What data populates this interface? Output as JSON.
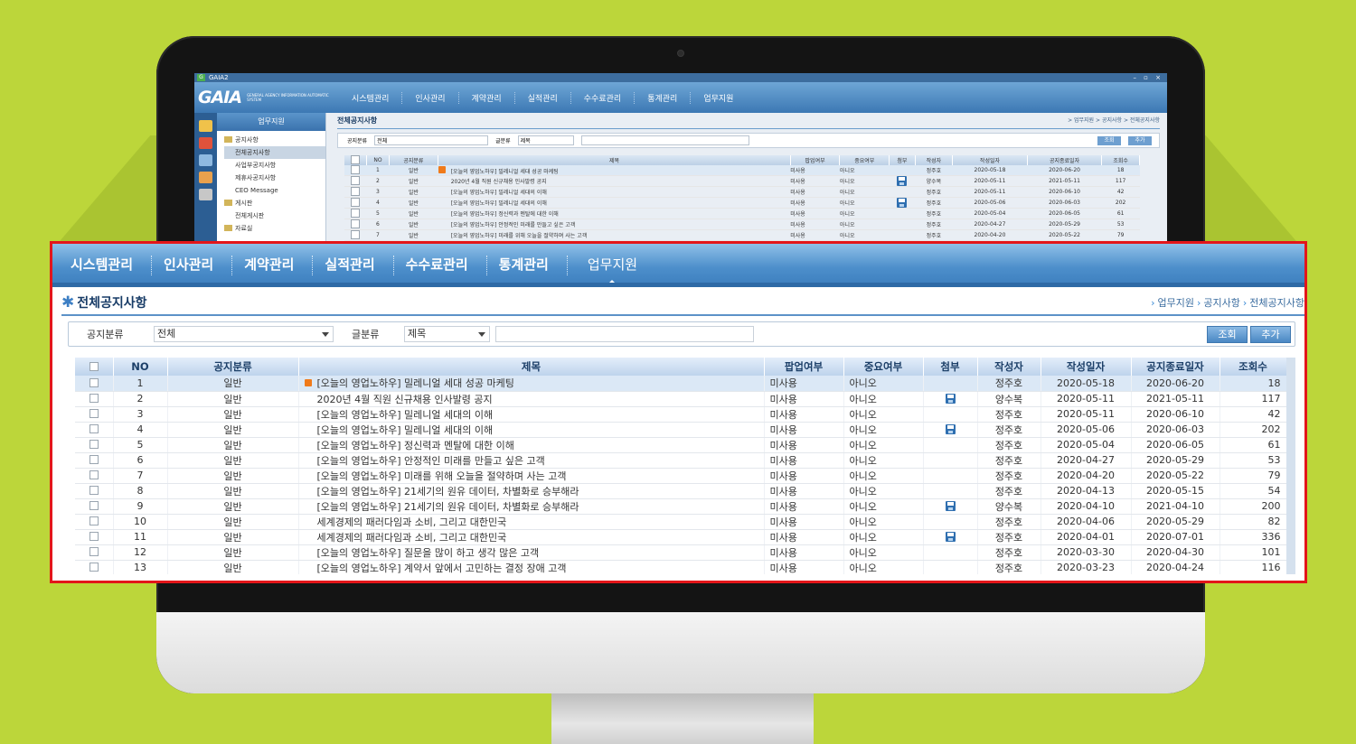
{
  "screen": {
    "app_title": "GAIA2",
    "logo": "GAIA",
    "logo_sub": "GENERAL AGENCY INFORMATION AUTOMATIC SYSTEM",
    "sidebar_title": "업무지원",
    "tree": [
      {
        "label": "공지사항",
        "type": "folder"
      },
      {
        "label": "전체공지사항",
        "type": "page",
        "selected": true
      },
      {
        "label": "사업부공지사항",
        "type": "page"
      },
      {
        "label": "제휴사공지사항",
        "type": "page"
      },
      {
        "label": "CEO Message",
        "type": "page"
      },
      {
        "label": "게시판",
        "type": "folder"
      },
      {
        "label": "전체게시판",
        "type": "page"
      },
      {
        "label": "자료실",
        "type": "folder"
      }
    ]
  },
  "menu": [
    {
      "label": "시스템관리"
    },
    {
      "label": "인사관리"
    },
    {
      "label": "계약관리"
    },
    {
      "label": "실적관리"
    },
    {
      "label": "수수료관리"
    },
    {
      "label": "통계관리"
    },
    {
      "label": "업무지원",
      "active": true
    }
  ],
  "page": {
    "title": "전체공지사항",
    "breadcrumb": [
      "업무지원",
      "공지사항",
      "전체공지사항"
    ]
  },
  "filter": {
    "category_label": "공지분류",
    "category_value": "전체",
    "type_label": "글분류",
    "type_value": "제목",
    "search_value": "",
    "search_button": "조회",
    "add_button": "추가"
  },
  "table": {
    "columns": [
      "NO",
      "공지분류",
      "제목",
      "팝업여부",
      "중요여부",
      "첨부",
      "작성자",
      "작성일자",
      "공지종료일자",
      "조회수"
    ],
    "rows": [
      {
        "no": "1",
        "category": "일반",
        "title": "[오늘의 영업노하우] 밀레니얼 세대 성공 마케팅",
        "popup": "미사용",
        "important": "아니오",
        "attach": false,
        "author": "정주호",
        "date": "2020-05-18",
        "end": "2020-06-20",
        "views": "18",
        "new": true
      },
      {
        "no": "2",
        "category": "일반",
        "title": "2020년 4월 직원 신규채용 인사발령 공지",
        "popup": "미사용",
        "important": "아니오",
        "attach": true,
        "author": "양수복",
        "date": "2020-05-11",
        "end": "2021-05-11",
        "views": "117"
      },
      {
        "no": "3",
        "category": "일반",
        "title": "[오늘의 영업노하우] 밀레니얼 세대의 이해",
        "popup": "미사용",
        "important": "아니오",
        "attach": false,
        "author": "정주호",
        "date": "2020-05-11",
        "end": "2020-06-10",
        "views": "42"
      },
      {
        "no": "4",
        "category": "일반",
        "title": "[오늘의 영업노하우] 밀레니얼 세대의 이해",
        "popup": "미사용",
        "important": "아니오",
        "attach": true,
        "author": "정주호",
        "date": "2020-05-06",
        "end": "2020-06-03",
        "views": "202"
      },
      {
        "no": "5",
        "category": "일반",
        "title": "[오늘의 영업노하우] 정신력과 멘탈에 대한 이해",
        "popup": "미사용",
        "important": "아니오",
        "attach": false,
        "author": "정주호",
        "date": "2020-05-04",
        "end": "2020-06-05",
        "views": "61"
      },
      {
        "no": "6",
        "category": "일반",
        "title": "[오늘의 영업노하우] 안정적인 미래를 만들고 싶은 고객",
        "popup": "미사용",
        "important": "아니오",
        "attach": false,
        "author": "정주호",
        "date": "2020-04-27",
        "end": "2020-05-29",
        "views": "53"
      },
      {
        "no": "7",
        "category": "일반",
        "title": "[오늘의 영업노하우] 미래를 위해 오늘을 절약하며 사는 고객",
        "popup": "미사용",
        "important": "아니오",
        "attach": false,
        "author": "정주호",
        "date": "2020-04-20",
        "end": "2020-05-22",
        "views": "79"
      },
      {
        "no": "8",
        "category": "일반",
        "title": "[오늘의 영업노하우] 21세기의 원유 데이터, 차별화로 승부해라",
        "popup": "미사용",
        "important": "아니오",
        "attach": false,
        "author": "정주호",
        "date": "2020-04-13",
        "end": "2020-05-15",
        "views": "54"
      },
      {
        "no": "9",
        "category": "일반",
        "title": "[오늘의 영업노하우] 21세기의 원유 데이터, 차별화로 승부해라",
        "popup": "미사용",
        "important": "아니오",
        "attach": true,
        "author": "양수복",
        "date": "2020-04-10",
        "end": "2021-04-10",
        "views": "200"
      },
      {
        "no": "10",
        "category": "일반",
        "title": "세계경제의 패러다임과 소비, 그리고 대한민국",
        "popup": "미사용",
        "important": "아니오",
        "attach": false,
        "author": "정주호",
        "date": "2020-04-06",
        "end": "2020-05-29",
        "views": "82"
      },
      {
        "no": "11",
        "category": "일반",
        "title": "세계경제의 패러다임과 소비, 그리고 대한민국",
        "popup": "미사용",
        "important": "아니오",
        "attach": true,
        "author": "정주호",
        "date": "2020-04-01",
        "end": "2020-07-01",
        "views": "336"
      },
      {
        "no": "12",
        "category": "일반",
        "title": "[오늘의 영업노하우] 질문을 많이 하고 생각 많은 고객",
        "popup": "미사용",
        "important": "아니오",
        "attach": false,
        "author": "정주호",
        "date": "2020-03-30",
        "end": "2020-04-30",
        "views": "101"
      },
      {
        "no": "13",
        "category": "일반",
        "title": "[오늘의 영업노하우] 계약서 앞에서 고민하는 결정 장애 고객",
        "popup": "미사용",
        "important": "아니오",
        "attach": false,
        "author": "정주호",
        "date": "2020-03-23",
        "end": "2020-04-24",
        "views": "116"
      }
    ]
  },
  "colors": {
    "background": "#bcd63a",
    "highlight_border": "#e3161a",
    "menu_blue": "#4d8fcb"
  }
}
